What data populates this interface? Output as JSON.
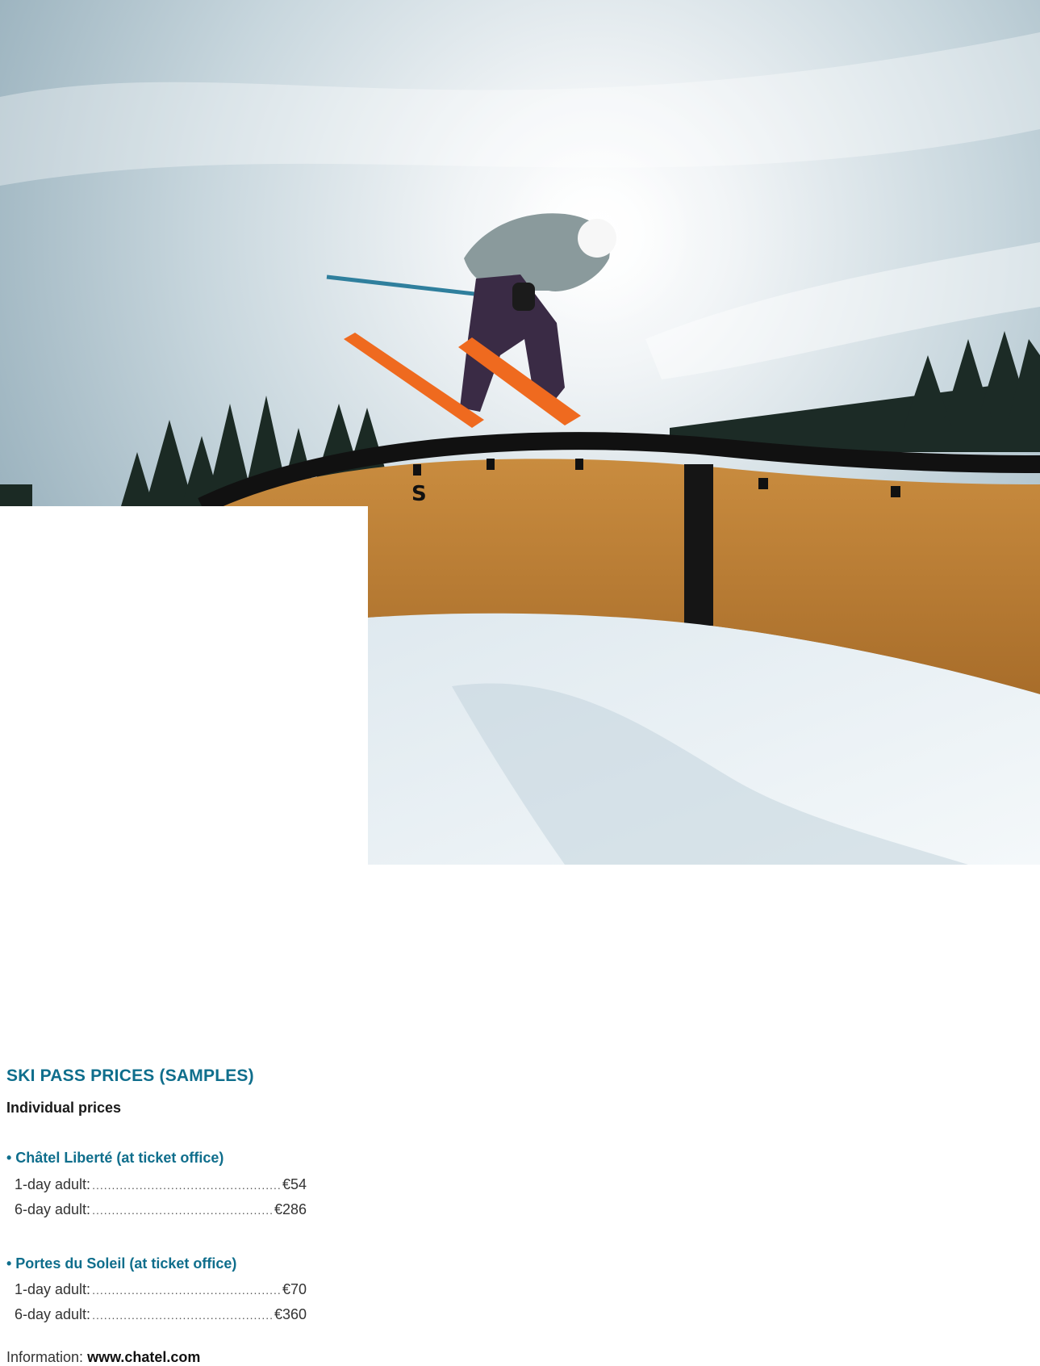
{
  "colors": {
    "accent": "#0f6e8c",
    "text": "#333333",
    "panel": "#ffffff"
  },
  "photo": {
    "alt": "skier on rail"
  },
  "panel": {
    "title": "SKI PASS PRICES (SAMPLES)",
    "subtitle": "Individual prices",
    "groups": [
      {
        "title": "• Châtel Liberté (at ticket office)",
        "rows": [
          {
            "label": "1-day adult:",
            "value": "€54"
          },
          {
            "label": "6-day adult:",
            "value": "€286"
          }
        ]
      },
      {
        "title": "• Portes du Soleil (at ticket office)",
        "rows": [
          {
            "label": "1-day adult:",
            "value": "€70"
          },
          {
            "label": "6-day adult:",
            "value": "€360"
          }
        ]
      }
    ],
    "info_label": "Information:",
    "info_link": "www.chatel.com"
  }
}
